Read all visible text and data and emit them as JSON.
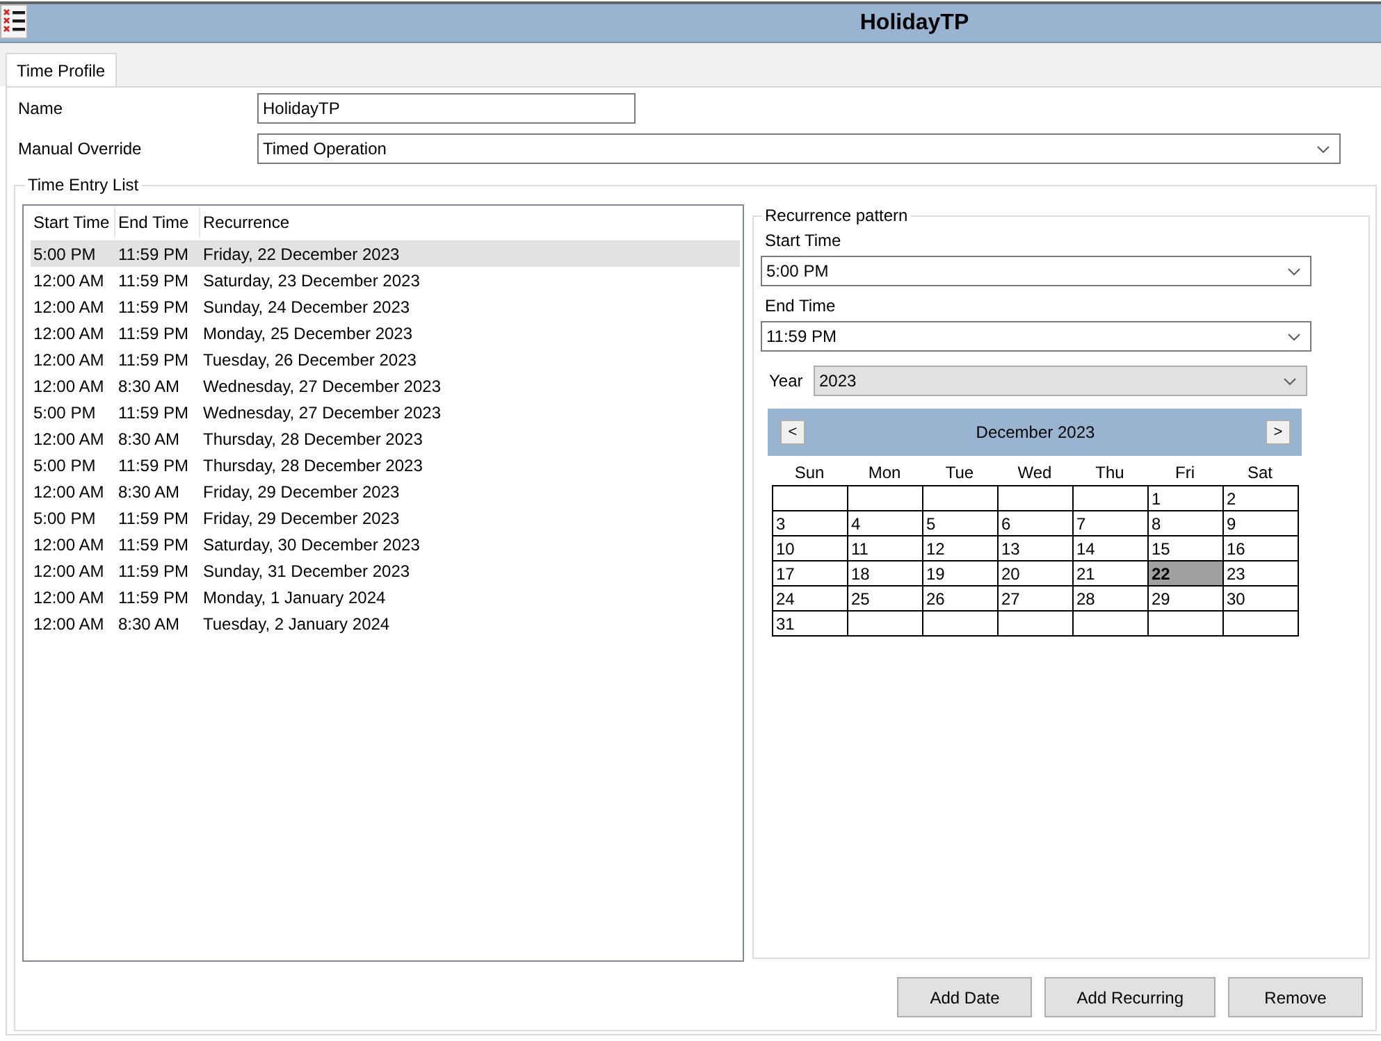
{
  "window": {
    "title": "HolidayTP"
  },
  "tabs": [
    {
      "label": "Time Profile",
      "selected": true
    }
  ],
  "fields": [
    {
      "label": "Name",
      "value": "HolidayTP",
      "kind": "text"
    },
    {
      "label": "Manual Override",
      "value": "Timed Operation",
      "kind": "dropdown"
    }
  ],
  "time_entry_list": {
    "title": "Time Entry List",
    "columns": [
      "Start Time",
      "End Time",
      "Recurrence"
    ],
    "rows": [
      {
        "cells": [
          "5:00 PM",
          "11:59 PM",
          "Friday, 22 December 2023"
        ],
        "selected": true
      },
      {
        "cells": [
          "12:00 AM",
          "11:59 PM",
          "Saturday, 23 December 2023"
        ],
        "selected": false
      },
      {
        "cells": [
          "12:00 AM",
          "11:59 PM",
          "Sunday, 24 December 2023"
        ],
        "selected": false
      },
      {
        "cells": [
          "12:00 AM",
          "11:59 PM",
          "Monday, 25 December 2023"
        ],
        "selected": false
      },
      {
        "cells": [
          "12:00 AM",
          "11:59 PM",
          "Tuesday, 26 December 2023"
        ],
        "selected": false
      },
      {
        "cells": [
          "12:00 AM",
          "8:30 AM",
          "Wednesday, 27 December 2023"
        ],
        "selected": false
      },
      {
        "cells": [
          "5:00 PM",
          "11:59 PM",
          "Wednesday, 27 December 2023"
        ],
        "selected": false
      },
      {
        "cells": [
          "12:00 AM",
          "8:30 AM",
          "Thursday, 28 December 2023"
        ],
        "selected": false
      },
      {
        "cells": [
          "5:00 PM",
          "11:59 PM",
          "Thursday, 28 December 2023"
        ],
        "selected": false
      },
      {
        "cells": [
          "12:00 AM",
          "8:30 AM",
          "Friday, 29 December 2023"
        ],
        "selected": false
      },
      {
        "cells": [
          "5:00 PM",
          "11:59 PM",
          "Friday, 29 December 2023"
        ],
        "selected": false
      },
      {
        "cells": [
          "12:00 AM",
          "11:59 PM",
          "Saturday, 30 December 2023"
        ],
        "selected": false
      },
      {
        "cells": [
          "12:00 AM",
          "11:59 PM",
          "Sunday, 31 December 2023"
        ],
        "selected": false
      },
      {
        "cells": [
          "12:00 AM",
          "11:59 PM",
          "Monday, 1 January 2024"
        ],
        "selected": false
      },
      {
        "cells": [
          "12:00 AM",
          "8:30 AM",
          "Tuesday, 2 January 2024"
        ],
        "selected": false
      }
    ]
  },
  "recurrence_pattern": {
    "title": "Recurrence pattern",
    "start_time": {
      "label": "Start Time",
      "value": "5:00 PM"
    },
    "end_time": {
      "label": "End Time",
      "value": "11:59 PM"
    },
    "year": {
      "label": "Year",
      "value": "2023"
    },
    "calendar": {
      "month": "December 2023",
      "previous": "<",
      "next": ">",
      "weekdays": [
        "Sun",
        "Mon",
        "Tue",
        "Wed",
        "Thu",
        "Fri",
        "Sat"
      ],
      "weeks": [
        [
          {
            "kind": "blank"
          },
          {
            "kind": "blank"
          },
          {
            "kind": "blank"
          },
          {
            "kind": "blank"
          },
          {
            "kind": "blank"
          },
          {
            "kind": "day",
            "label": "1",
            "selected": false
          },
          {
            "kind": "day",
            "label": "2",
            "selected": false
          }
        ],
        [
          {
            "kind": "day",
            "label": "3",
            "selected": false
          },
          {
            "kind": "day",
            "label": "4",
            "selected": false
          },
          {
            "kind": "day",
            "label": "5",
            "selected": false
          },
          {
            "kind": "day",
            "label": "6",
            "selected": false
          },
          {
            "kind": "day",
            "label": "7",
            "selected": false
          },
          {
            "kind": "day",
            "label": "8",
            "selected": false
          },
          {
            "kind": "day",
            "label": "9",
            "selected": false
          }
        ],
        [
          {
            "kind": "day",
            "label": "10",
            "selected": false
          },
          {
            "kind": "day",
            "label": "11",
            "selected": false
          },
          {
            "kind": "day",
            "label": "12",
            "selected": false
          },
          {
            "kind": "day",
            "label": "13",
            "selected": false
          },
          {
            "kind": "day",
            "label": "14",
            "selected": false
          },
          {
            "kind": "day",
            "label": "15",
            "selected": false
          },
          {
            "kind": "day",
            "label": "16",
            "selected": false
          }
        ],
        [
          {
            "kind": "day",
            "label": "17",
            "selected": false
          },
          {
            "kind": "day",
            "label": "18",
            "selected": false
          },
          {
            "kind": "day",
            "label": "19",
            "selected": false
          },
          {
            "kind": "day",
            "label": "20",
            "selected": false
          },
          {
            "kind": "day",
            "label": "21",
            "selected": false
          },
          {
            "kind": "day",
            "label": "22",
            "selected": true
          },
          {
            "kind": "day",
            "label": "23",
            "selected": false
          }
        ],
        [
          {
            "kind": "day",
            "label": "24",
            "selected": false
          },
          {
            "kind": "day",
            "label": "25",
            "selected": false
          },
          {
            "kind": "day",
            "label": "26",
            "selected": false
          },
          {
            "kind": "day",
            "label": "27",
            "selected": false
          },
          {
            "kind": "day",
            "label": "28",
            "selected": false
          },
          {
            "kind": "day",
            "label": "29",
            "selected": false
          },
          {
            "kind": "day",
            "label": "30",
            "selected": false
          }
        ],
        [
          {
            "kind": "day",
            "label": "31",
            "selected": false
          },
          {
            "kind": "blank"
          },
          {
            "kind": "blank"
          },
          {
            "kind": "blank"
          },
          {
            "kind": "blank"
          },
          {
            "kind": "blank"
          },
          {
            "kind": "blank"
          }
        ]
      ]
    }
  },
  "buttons": [
    "Add Date",
    "Add Recurring",
    "Remove"
  ]
}
